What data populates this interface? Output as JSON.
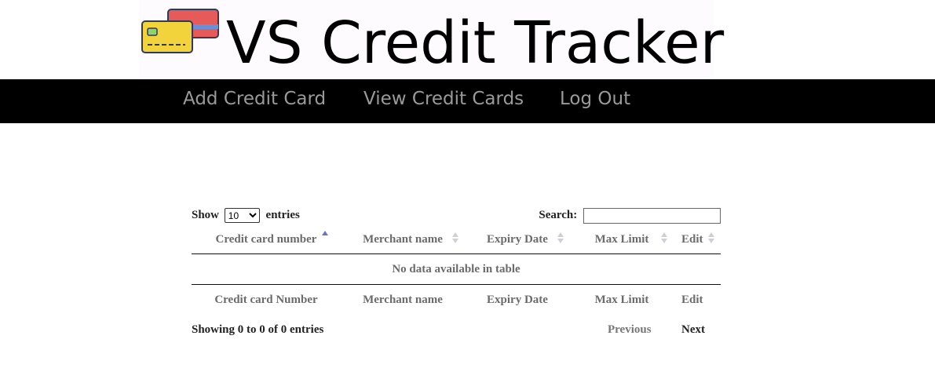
{
  "header": {
    "title": "VS Credit Tracker",
    "logo_icon": "credit-cards-icon"
  },
  "nav": {
    "items": [
      {
        "label": "Add Credit Card"
      },
      {
        "label": "View Credit Cards"
      },
      {
        "label": "Log Out"
      }
    ]
  },
  "table_controls": {
    "show_label": "Show",
    "entries_label": "entries",
    "length_value": "10",
    "search_label": "Search:",
    "search_value": ""
  },
  "table": {
    "headers": [
      "Credit card number",
      "Merchant name",
      "Expiry Date",
      "Max Limit",
      "Edit"
    ],
    "empty_message": "No data available in table",
    "footers": [
      "Credit card Number",
      "Merchant name",
      "Expiry Date",
      "Max Limit",
      "Edit"
    ],
    "sorted_column": "Credit card number",
    "sort_direction": "ascending"
  },
  "info": "Showing 0 to 0 of 0 entries",
  "pagination": {
    "previous": "Previous",
    "next": "Next"
  },
  "colors": {
    "nav_bg": "#000000",
    "nav_text": "#9a9a9a",
    "sort_active": "#6b73c8"
  }
}
